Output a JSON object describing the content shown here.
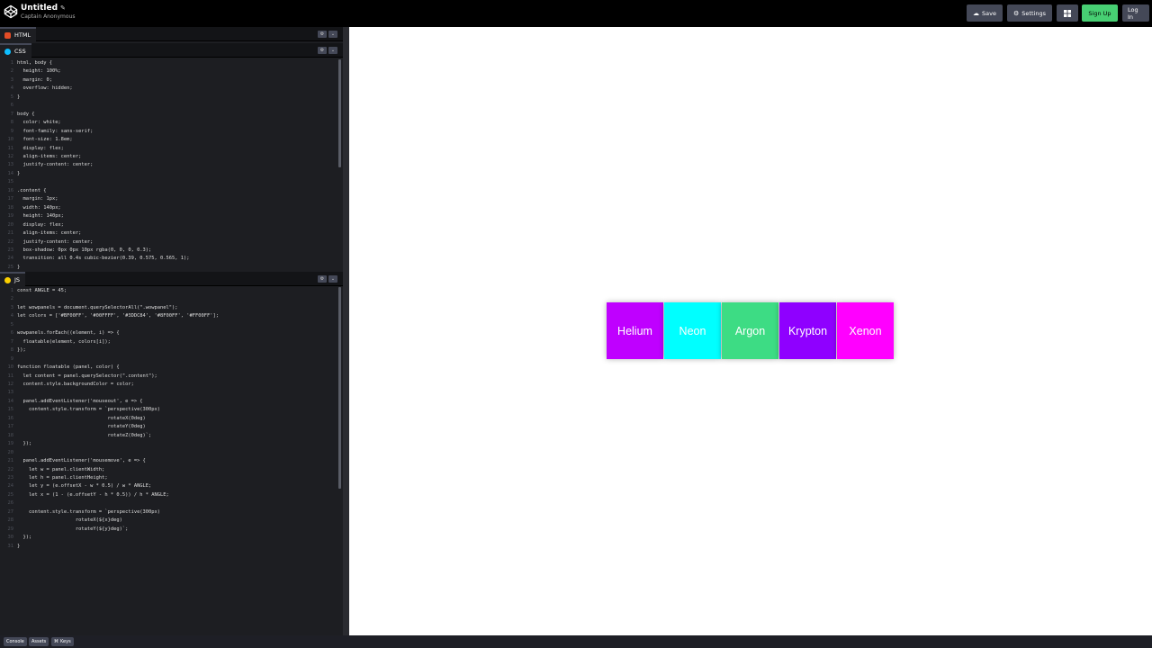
{
  "header": {
    "title": "Untitled",
    "subtitle": "Captain Anonymous",
    "buttons": {
      "save": "Save",
      "settings": "Settings",
      "signup": "Sign Up",
      "login": "Log In"
    }
  },
  "tabs": {
    "html": {
      "label": "HTML",
      "color": "#e34c26"
    },
    "css": {
      "label": "CSS",
      "color": "#0ebeff"
    },
    "js": {
      "label": "JS",
      "color": "#fcd000"
    }
  },
  "css_lines": [
    "html, body {",
    "  height: 100%;",
    "  margin: 0;",
    "  overflow: hidden;",
    "}",
    "",
    "body {",
    "  color: white;",
    "  font-family: sans-serif;",
    "  font-size: 1.8em;",
    "  display: flex;",
    "  align-items: center;",
    "  justify-content: center;",
    "}",
    "",
    ".content {",
    "  margin: 1px;",
    "  width: 140px;",
    "  height: 140px;",
    "  display: flex;",
    "  align-items: center;",
    "  justify-content: center;",
    "  box-shadow: 0px 0px 10px rgba(0, 0, 0, 0.3);",
    "  transition: all 0.4s cubic-bezier(0.39, 0.575, 0.565, 1);",
    "}"
  ],
  "js_lines": [
    "const ANGLE = 45;",
    "",
    "let wowpanels = document.querySelectorAll(\".wowpanel\");",
    "let colors = ['#BF00FF', '#00FFFF', '#3DDC84', '#8F00FF', '#FF00FF'];",
    "",
    "wowpanels.forEach((element, i) => {",
    "  floatable(element, colors[i]);",
    "});",
    "",
    "function floatable (panel, color) {",
    "  let content = panel.querySelector(\".content\");",
    "  content.style.backgroundColor = color;",
    "",
    "  panel.addEventListener('mouseout', e => {",
    "    content.style.transform = `perspective(300px)",
    "                               rotateX(0deg)",
    "                               rotateY(0deg)",
    "                               rotateZ(0deg)`;",
    "  });",
    "",
    "  panel.addEventListener('mousemove', e => {",
    "    let w = panel.clientWidth;",
    "    let h = panel.clientHeight;",
    "    let y = (e.offsetX - w * 0.5) / w * ANGLE;",
    "    let x = (1 - (e.offsetY - h * 0.5)) / h * ANGLE;",
    "",
    "    content.style.transform = `perspective(300px)",
    "                    rotateX(${x}deg)",
    "                    rotateY(${y}deg)`;",
    "  });",
    "}"
  ],
  "preview": {
    "panels": [
      {
        "label": "Helium",
        "color": "#BF00FF"
      },
      {
        "label": "Neon",
        "color": "#00FFFF"
      },
      {
        "label": "Argon",
        "color": "#3DDC84"
      },
      {
        "label": "Krypton",
        "color": "#8F00FF"
      },
      {
        "label": "Xenon",
        "color": "#FF00FF"
      }
    ]
  },
  "footer": {
    "console": "Console",
    "assets": "Assets",
    "keys": "Keys"
  }
}
